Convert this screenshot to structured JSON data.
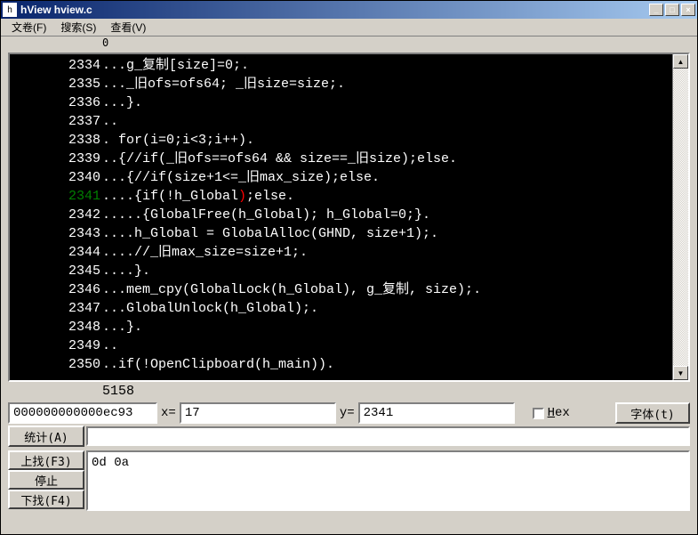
{
  "window": {
    "title": "hView hview.c",
    "min": "_",
    "max": "□",
    "close": "×"
  },
  "menu": {
    "file": "文卷(F)",
    "search": "搜索(S)",
    "view": "查看(V)"
  },
  "ruler": {
    "mark0": "0"
  },
  "code": [
    {
      "num": "2334",
      "text": "...g_复制[size]=0;.",
      "hl": false
    },
    {
      "num": "2335",
      "text": "..._旧ofs=ofs64; _旧size=size;.",
      "hl": false
    },
    {
      "num": "2336",
      "text": "...}.",
      "hl": false
    },
    {
      "num": "2337",
      "text": "..",
      "hl": false
    },
    {
      "num": "2338",
      "text": ". for(i=0;i<3;i++).",
      "hl": false
    },
    {
      "num": "2339",
      "text": "..{//if(_旧ofs==ofs64 && size==_旧size);else.",
      "hl": false
    },
    {
      "num": "2340",
      "text": "...{//if(size+1<=_旧max_size);else.",
      "hl": false
    },
    {
      "num": "2341",
      "text": "....{if(!h_Global);else.",
      "hl": true
    },
    {
      "num": "2342",
      "text": ".....{GlobalFree(h_Global); h_Global=0;}.",
      "hl": false
    },
    {
      "num": "2343",
      "text": "....h_Global = GlobalAlloc(GHND, size+1);.",
      "hl": false
    },
    {
      "num": "2344",
      "text": "....//_旧max_size=size+1;.",
      "hl": false
    },
    {
      "num": "2345",
      "text": "....}.",
      "hl": false
    },
    {
      "num": "2346",
      "text": "...mem_cpy(GlobalLock(h_Global), g_复制, size);.",
      "hl": false
    },
    {
      "num": "2347",
      "text": "...GlobalUnlock(h_Global);.",
      "hl": false
    },
    {
      "num": "2348",
      "text": "...}.",
      "hl": false
    },
    {
      "num": "2349",
      "text": "..",
      "hl": false
    },
    {
      "num": "2350",
      "text": "..if(!OpenClipboard(h_main)).",
      "hl": false
    }
  ],
  "total_lines": "5158",
  "controls": {
    "address": "000000000000ec93",
    "x_label": "x=",
    "x_value": "17",
    "y_label": "y=",
    "y_value": "2341",
    "hex_label": "Hex",
    "font_btn": "字体(t)"
  },
  "buttons": {
    "stat": "统计(A)",
    "find_up": "上找(F3)",
    "stop": "停止",
    "find_down": "下找(F4)"
  },
  "search_text": "0d 0a"
}
